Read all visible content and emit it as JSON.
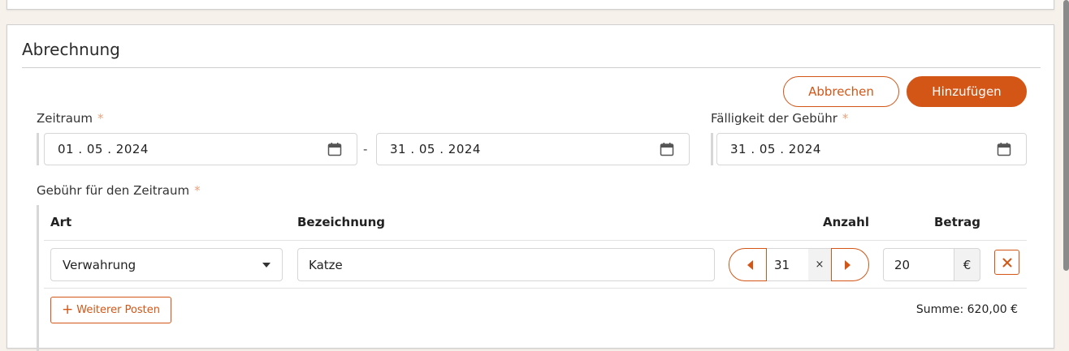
{
  "section": {
    "title": "Abrechnung"
  },
  "actions": {
    "cancel_label": "Abbrechen",
    "add_label": "Hinzufügen"
  },
  "period": {
    "label": "Zeitraum",
    "required_mark": "*",
    "from": "01 . 05 . 2024",
    "separator": "-",
    "to": "31 . 05 . 2024"
  },
  "due": {
    "label": "Fälligkeit der Gebühr",
    "required_mark": "*",
    "value": "31 . 05 . 2024"
  },
  "fee": {
    "label": "Gebühr für den Zeitraum",
    "required_mark": "*",
    "columns": {
      "art": "Art",
      "bezeichnung": "Bezeichnung",
      "anzahl": "Anzahl",
      "betrag": "Betrag"
    },
    "rows": [
      {
        "art": "Verwahrung",
        "bezeichnung": "Katze",
        "anzahl": "31",
        "multiply": "×",
        "betrag": "20",
        "currency": "€"
      }
    ],
    "add_more_label": "Weiterer Posten",
    "sum_text": "Summe: 620,00 €"
  },
  "colors": {
    "accent": "#d35617",
    "page_bg": "#f7f1ec"
  },
  "icons": {
    "calendar": "calendar-icon",
    "dropdown": "chevron-down-icon",
    "decrement": "triangle-left-icon",
    "increment": "triangle-right-icon",
    "remove": "close-icon",
    "add": "plus-icon"
  }
}
